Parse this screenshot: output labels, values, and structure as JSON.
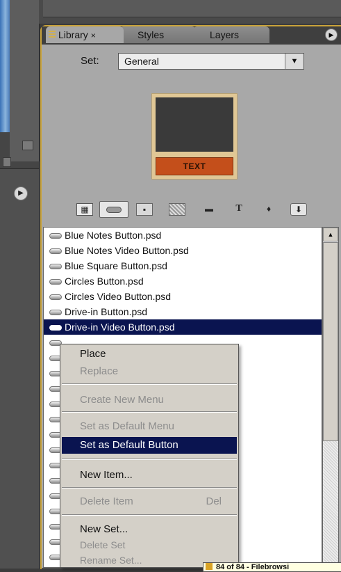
{
  "tabs": [
    {
      "label": "Library",
      "close": "×"
    },
    {
      "label": "Styles"
    },
    {
      "label": "Layers"
    }
  ],
  "set": {
    "label": "Set:",
    "value": "General"
  },
  "preview": {
    "button_text": "TEXT"
  },
  "list": {
    "items": [
      "Blue Notes Button.psd",
      "Blue Notes Video Button.psd",
      "Blue Square Button.psd",
      "Circles Button.psd",
      "Circles Video Button.psd",
      "Drive-in Button.psd",
      "Drive-in Video Button.psd"
    ],
    "selected_index": 6
  },
  "context_menu": {
    "place": "Place",
    "replace": "Replace",
    "create_new_menu": "Create New Menu",
    "set_default_menu": "Set as Default Menu",
    "set_default_button": "Set as Default Button",
    "new_item": "New Item...",
    "delete_item": "Delete Item",
    "delete_item_shortcut": "Del",
    "new_set": "New Set...",
    "delete_set": "Delete Set",
    "rename_set": "Rename Set..."
  },
  "tooltip": {
    "text": "84 of 84 - Filebrowsi"
  },
  "colors": {
    "accent": "#c9a33a",
    "selection": "#0a1450",
    "preview_button": "#c44f1b"
  }
}
